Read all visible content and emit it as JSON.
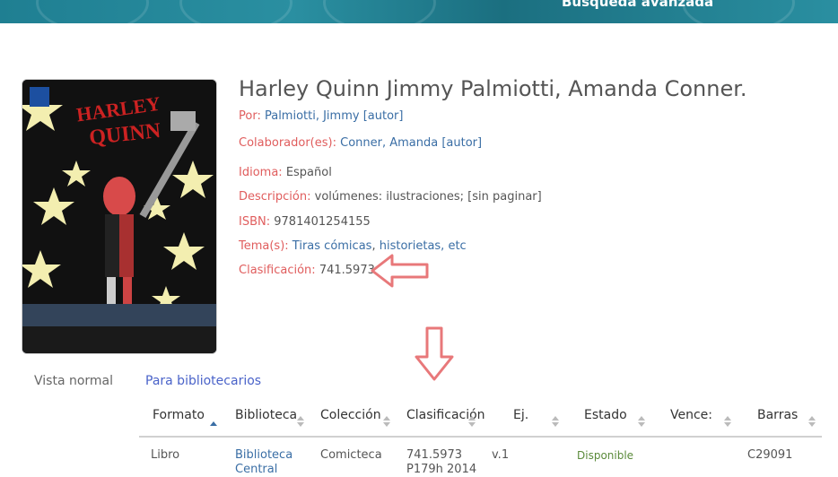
{
  "header": {
    "advanced_search": "Búsqueda avanzada"
  },
  "record": {
    "title": "Harley Quinn Jimmy Palmiotti, Amanda Conner.",
    "por_label": "Por:",
    "por_value": "Palmiotti, Jimmy [autor]",
    "colab_label": "Colaborador(es):",
    "colab_value": "Conner, Amanda [autor]",
    "idioma_label": "Idioma:",
    "idioma_value": "Español",
    "desc_label": "Descripción:",
    "desc_value": "volúmenes: ilustraciones; [sin paginar]",
    "isbn_label": "ISBN:",
    "isbn_value": "9781401254155",
    "tema_label": "Tema(s):",
    "tema_value_1": "Tiras cómicas",
    "tema_sep": ",",
    "tema_value_2": "historietas, etc",
    "clasif_label": "Clasificación:",
    "clasif_value": "741.5973"
  },
  "cover": {
    "icon": "book-cover-image",
    "lettering": "HARLEY QUINN"
  },
  "tabs": {
    "normal": "Vista normal",
    "librarians": "Para bibliotecarios"
  },
  "table": {
    "headers": [
      "Formato",
      "Biblioteca",
      "Colección",
      "Clasificación",
      "Ej.",
      "Estado",
      "Vence:",
      "Barras"
    ],
    "row": {
      "formato": "Libro",
      "biblioteca_1": "Biblioteca",
      "biblioteca_2": "Central",
      "coleccion": "Comicteca",
      "clasif_1": "741.5973",
      "clasif_2": "P179h 2014",
      "ejemplar": "v.1",
      "estado": "Disponible",
      "vence": "",
      "barras": "C29091"
    }
  },
  "colors": {
    "label": "#e05d5d",
    "link": "#3a6ea5",
    "annotation_arrow": "#e8787a",
    "banner": "#1f7f92",
    "available": "#5a8a3a"
  }
}
